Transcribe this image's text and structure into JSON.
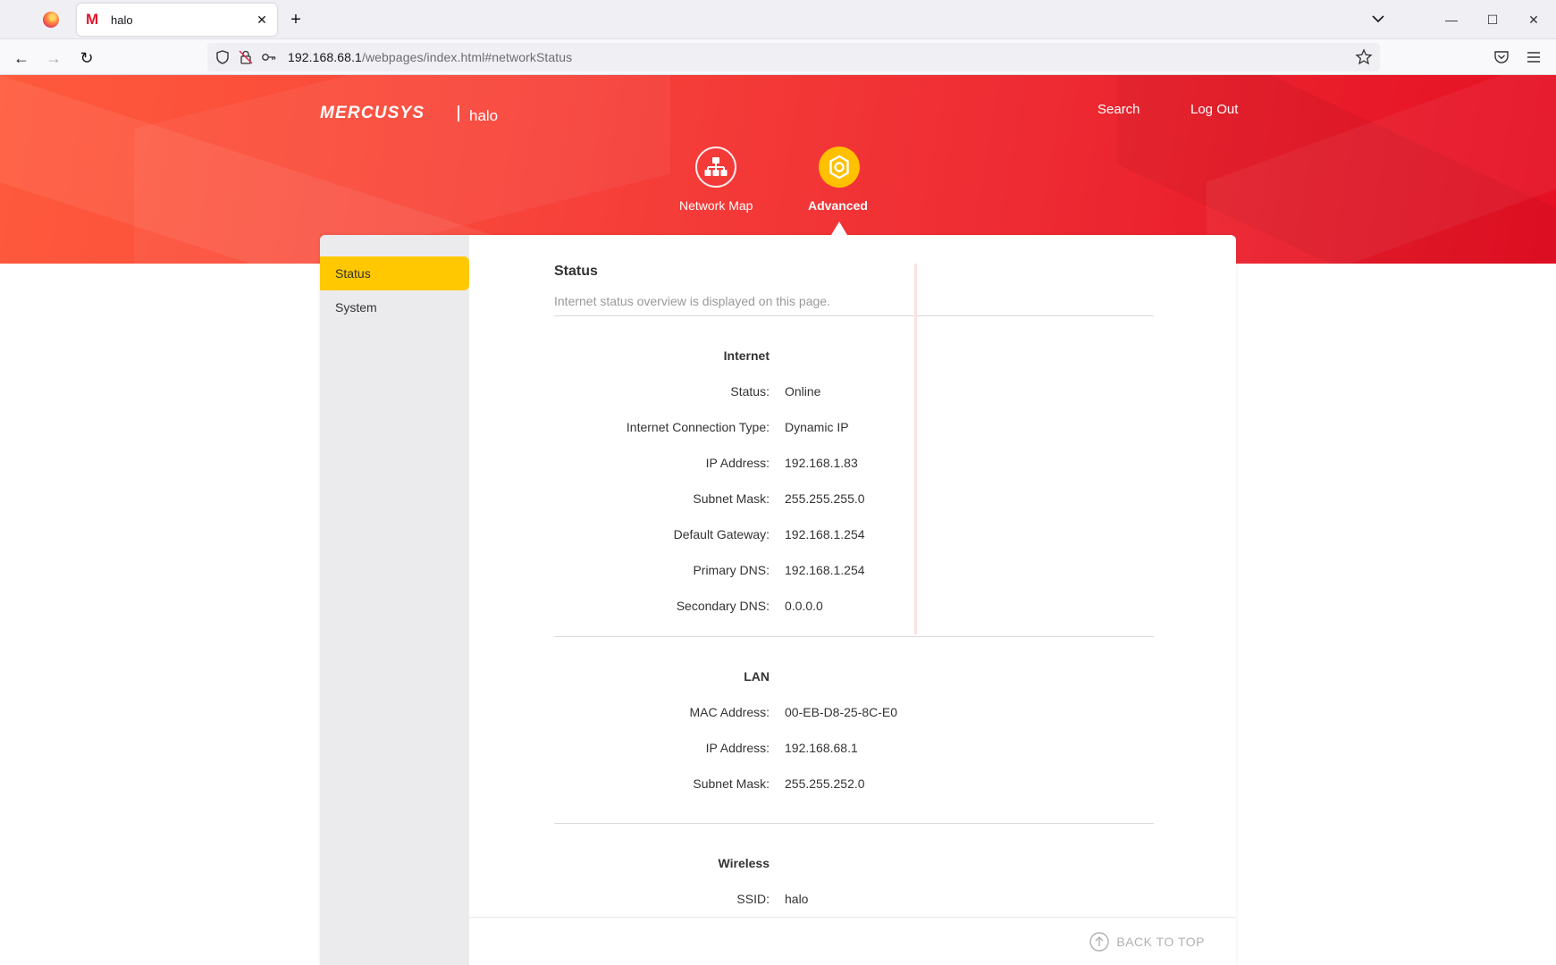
{
  "browser": {
    "tab_title": "halo",
    "tab_favicon": "M",
    "url_host": "192.168.68.1",
    "url_path": "/webpages/index.html#networkStatus",
    "icons": [
      "firefox-icon",
      "close-icon",
      "plus-icon",
      "chevron-down-icon",
      "minimize-icon",
      "maximize-icon",
      "window-close-icon",
      "back-arrow-icon",
      "forward-arrow-icon",
      "reload-icon",
      "shield-icon",
      "tracking-lock-icon",
      "key-icon",
      "star-icon",
      "pocket-icon",
      "hamburger-menu-icon"
    ],
    "win_min": "—",
    "win_max": "☐",
    "win_close": "✕",
    "back": "←",
    "forward": "→",
    "reload": "↻",
    "close": "✕",
    "new_tab": "+"
  },
  "header": {
    "brand": "MERCUSYS",
    "model": "halo",
    "search_label": "Search",
    "logout_label": "Log Out",
    "nav": [
      {
        "label": "Network Map",
        "icon": "network-map-icon"
      },
      {
        "label": "Advanced",
        "icon": "gear-icon",
        "active": true
      }
    ]
  },
  "sidebar": {
    "items": [
      {
        "label": "Status",
        "active": true
      },
      {
        "label": "System"
      }
    ]
  },
  "content": {
    "title": "Status",
    "description": "Internet status overview is displayed on this page.",
    "internet": {
      "title": "Internet",
      "rows": [
        {
          "label": "Status:",
          "value": "Online"
        },
        {
          "label": "Internet Connection Type:",
          "value": "Dynamic IP"
        },
        {
          "label": "IP Address:",
          "value": "192.168.1.83"
        },
        {
          "label": "Subnet Mask:",
          "value": "255.255.255.0"
        },
        {
          "label": "Default Gateway:",
          "value": "192.168.1.254"
        },
        {
          "label": "Primary DNS:",
          "value": "192.168.1.254"
        },
        {
          "label": "Secondary DNS:",
          "value": "0.0.0.0"
        }
      ]
    },
    "lan": {
      "title": "LAN",
      "rows": [
        {
          "label": "MAC Address:",
          "value": "00-EB-D8-25-8C-E0"
        },
        {
          "label": "IP Address:",
          "value": "192.168.68.1"
        },
        {
          "label": "Subnet Mask:",
          "value": "255.255.252.0"
        }
      ]
    },
    "wireless": {
      "title": "Wireless",
      "rows": [
        {
          "label": "SSID:",
          "value": "halo"
        }
      ]
    },
    "back_to_top": "BACK TO TOP"
  },
  "colors": {
    "brand_red": "#ee2b33",
    "accent_yellow": "#ffc800"
  }
}
